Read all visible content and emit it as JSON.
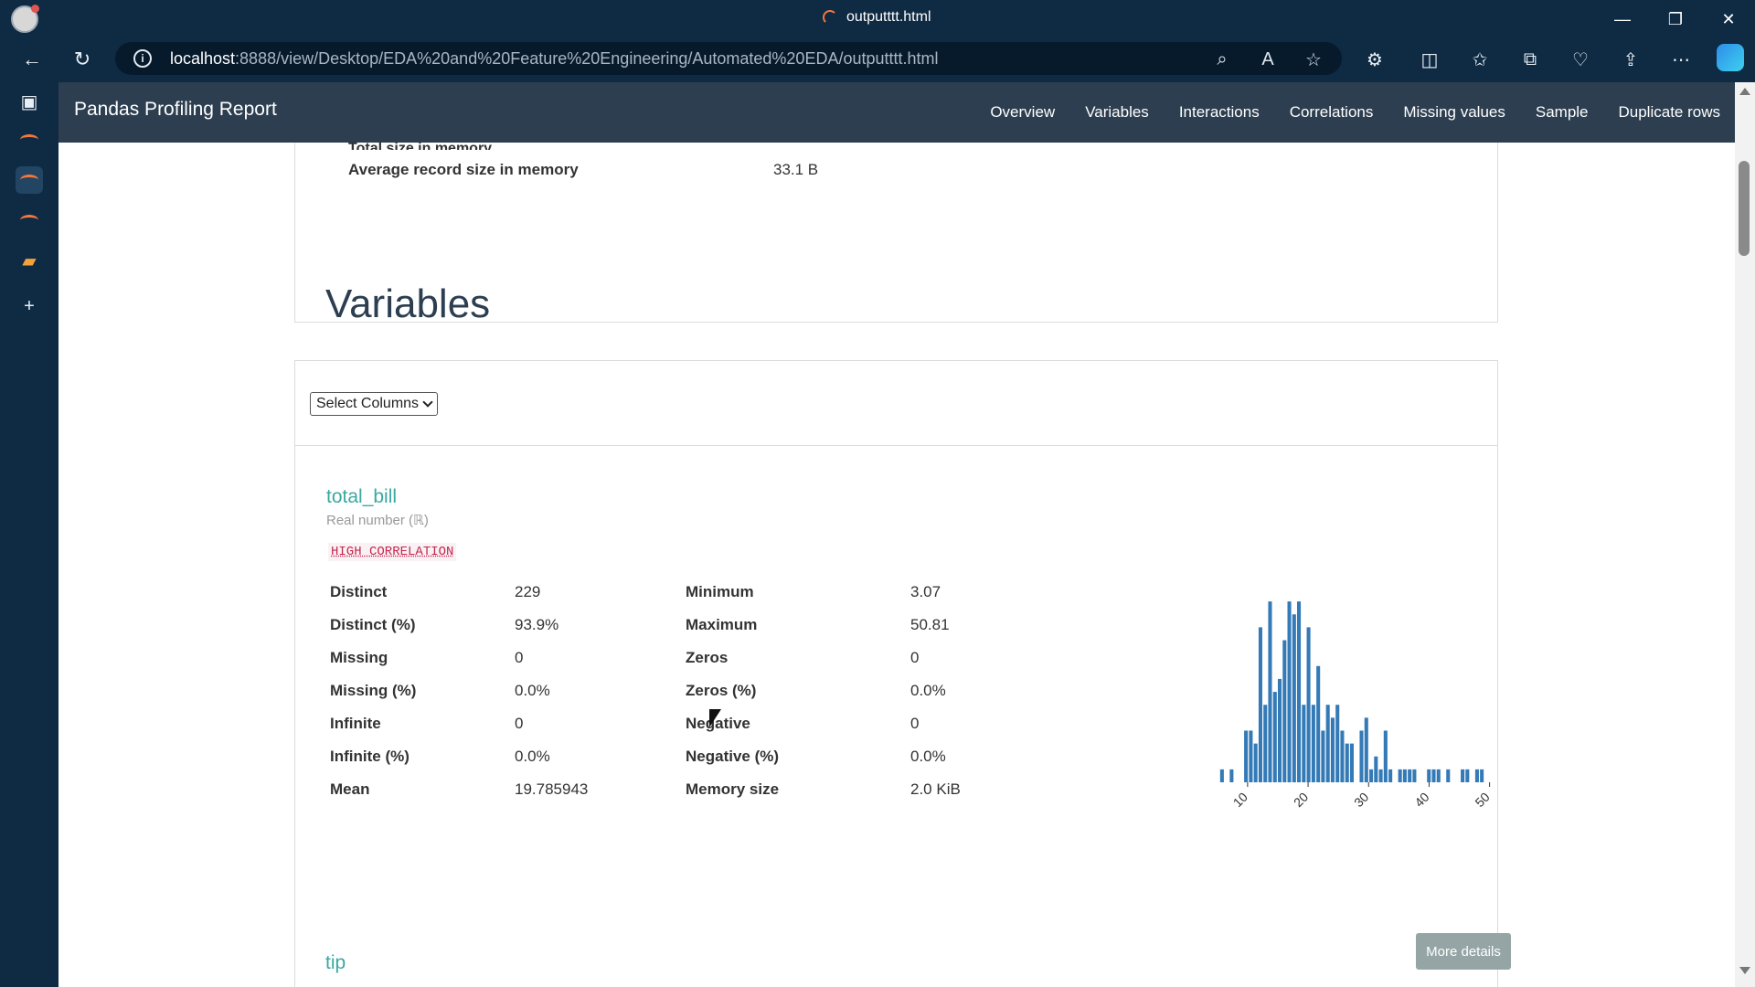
{
  "browser": {
    "tab_title": "outputttt.html",
    "url_host": "localhost",
    "url_rest": ":8888/view/Desktop/EDA%20and%20Feature%20Engineering/Automated%20EDA/outputttt.html"
  },
  "report": {
    "brand": "Pandas Profiling Report",
    "nav": [
      "Overview",
      "Variables",
      "Interactions",
      "Correlations",
      "Missing values",
      "Sample",
      "Duplicate rows"
    ]
  },
  "overview_tail": {
    "cut_label": "Total size in memory",
    "memory_label": "Average record size in memory",
    "memory_value": "33.1 B"
  },
  "variables": {
    "title": "Variables",
    "select_label": "Select Columns"
  },
  "total_bill": {
    "name": "total_bill",
    "type": "Real number (ℝ)",
    "badge": "HIGH CORRELATION",
    "stats_left": [
      {
        "label": "Distinct",
        "value": "229"
      },
      {
        "label": "Distinct (%)",
        "value": "93.9%"
      },
      {
        "label": "Missing",
        "value": "0"
      },
      {
        "label": "Missing (%)",
        "value": "0.0%"
      },
      {
        "label": "Infinite",
        "value": "0"
      },
      {
        "label": "Infinite (%)",
        "value": "0.0%"
      },
      {
        "label": "Mean",
        "value": "19.785943"
      }
    ],
    "stats_right": [
      {
        "label": "Minimum",
        "value": "3.07"
      },
      {
        "label": "Maximum",
        "value": "50.81"
      },
      {
        "label": "Zeros",
        "value": "0"
      },
      {
        "label": "Zeros (%)",
        "value": "0.0%"
      },
      {
        "label": "Negative",
        "value": "0"
      },
      {
        "label": "Negative (%)",
        "value": "0.0%"
      },
      {
        "label": "Memory size",
        "value": "2.0 KiB"
      }
    ],
    "more_details": "More details"
  },
  "next_variable": "tip",
  "chart_data": {
    "type": "bar",
    "title": "",
    "xlabel": "",
    "ylabel": "",
    "xlim": [
      3.07,
      50.81
    ],
    "ylim": [
      0,
      15
    ],
    "x_ticks": [
      "10",
      "20",
      "30",
      "40",
      "50"
    ],
    "bar_color": "#337ab7",
    "bins_left": [
      3.07,
      3.87,
      4.66,
      5.46,
      6.25,
      7.05,
      7.84,
      8.64,
      9.43,
      10.23,
      11.02,
      11.82,
      12.62,
      13.41,
      14.21,
      15.0,
      15.8,
      16.59,
      17.39,
      18.18,
      18.98,
      19.77,
      20.57,
      21.37,
      22.16,
      22.96,
      23.75,
      24.55,
      25.34,
      26.14,
      26.93,
      27.73,
      28.52,
      29.32,
      30.12,
      30.91,
      31.71,
      32.5,
      33.3,
      34.09,
      34.89,
      35.68,
      36.48,
      37.27,
      38.07,
      38.87,
      39.66,
      40.46,
      41.25,
      42.05,
      42.84,
      43.64,
      44.43,
      45.23,
      46.02,
      46.82,
      47.62,
      48.41,
      49.21,
      50.0
    ],
    "counts": [
      0,
      0,
      0,
      1,
      0,
      1,
      0,
      0,
      4,
      4,
      3,
      12,
      6,
      14,
      7,
      8,
      11,
      14,
      13,
      14,
      6,
      12,
      6,
      9,
      4,
      6,
      5,
      6,
      4,
      3,
      3,
      0,
      4,
      5,
      1,
      2,
      1,
      4,
      1,
      0,
      1,
      1,
      1,
      1,
      0,
      0,
      1,
      1,
      1,
      0,
      1,
      0,
      0,
      1,
      1,
      0,
      1,
      1,
      0,
      0
    ]
  }
}
